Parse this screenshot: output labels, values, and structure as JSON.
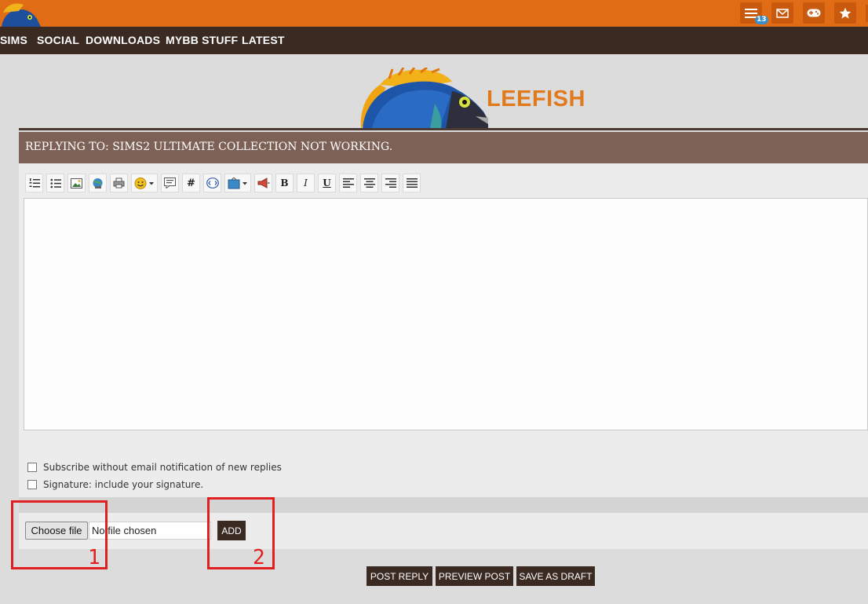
{
  "colors": {
    "orange": "#e06c16",
    "nav_brown": "#3a2a22",
    "reply_bar": "#7d6156",
    "logo_orange": "#e07a1c",
    "annotation_red": "#e02020"
  },
  "topbar": {
    "icons": [
      {
        "name": "list-icon",
        "badge": "13"
      },
      {
        "name": "mail-icon"
      },
      {
        "name": "gamepad-icon"
      },
      {
        "name": "star-icon"
      }
    ]
  },
  "nav": {
    "items": [
      "SIMS",
      "SOCIAL",
      "DOWNLOADS",
      "MYBB STUFF",
      "LATEST"
    ]
  },
  "logo": {
    "text": "LEEFISH"
  },
  "reply": {
    "title": "REPLYING TO: SIMS2 ULTIMATE COLLECTION NOT WORKING."
  },
  "toolbar": {
    "buttons": [
      "ordered-list-icon",
      "unordered-list-icon",
      "image-icon",
      "link-icon",
      "print-icon",
      "emoticon-icon",
      "quote-icon",
      "hash-icon",
      "code-icon",
      "video-icon",
      "announce-icon",
      "bold-icon",
      "italic-icon",
      "underline-icon",
      "align-left-icon",
      "align-center-icon",
      "align-right-icon",
      "justify-icon"
    ],
    "bold": "B",
    "italic": "I",
    "underline": "U",
    "hash": "#"
  },
  "options": {
    "subscribe": "Subscribe without email notification of new replies",
    "signature": "Signature: include your signature."
  },
  "attach": {
    "choose_label": "Choose file",
    "file_status": "No file chosen",
    "add_label": "ADD"
  },
  "actions": {
    "post_reply": "POST REPLY",
    "preview": "PREVIEW POST",
    "draft": "SAVE AS DRAFT"
  },
  "annotations": {
    "one": "1",
    "two": "2"
  }
}
